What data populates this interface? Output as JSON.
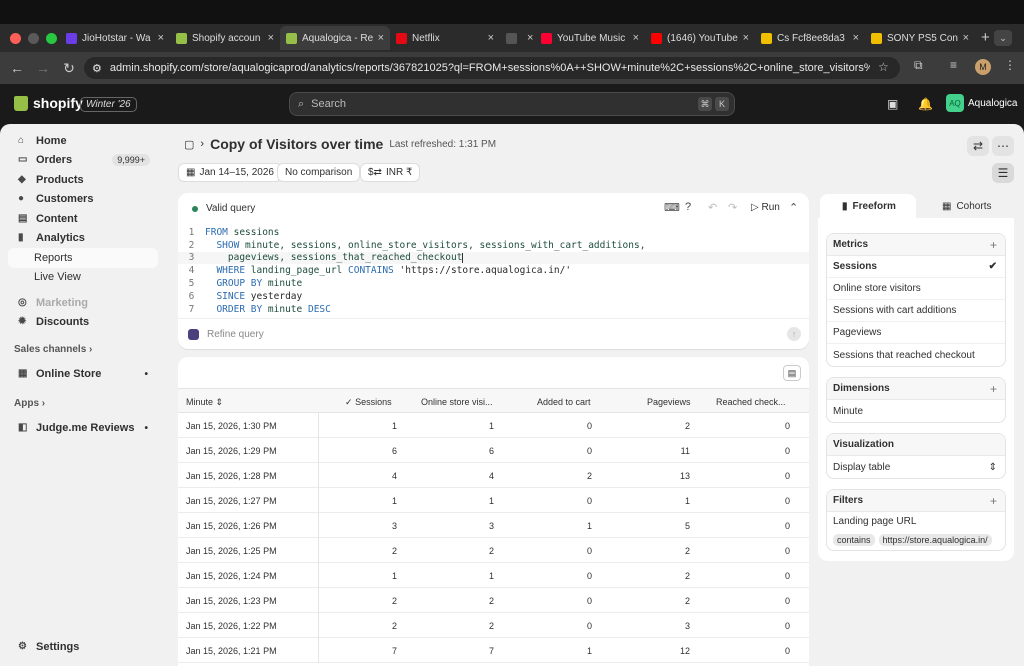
{
  "browser": {
    "tabs": [
      {
        "title": "JioHotstar - Wa",
        "color": "#6a3de8"
      },
      {
        "title": "Shopify accoun",
        "color": "#95bf47"
      },
      {
        "title": "Aqualogica - Re",
        "color": "#95bf47"
      },
      {
        "title": "Netflix",
        "color": "#e50914"
      },
      {
        "title": "",
        "color": "#555555"
      },
      {
        "title": "YouTube Music",
        "color": "#ff0033"
      },
      {
        "title": "(1646) YouTube",
        "color": "#ff0000"
      },
      {
        "title": "Cs Fcf8ee8da3",
        "color": "#f0c000"
      },
      {
        "title": "SONY PS5 Con",
        "color": "#f0c000"
      }
    ],
    "url": "admin.shopify.com/store/aqualogicaprod/analytics/reports/367821025?ql=FROM+sessions%0A++SHOW+minute%2C+sessions%2C+online_store_visitors%2C+ses...",
    "profile_initial": "M"
  },
  "appbar": {
    "logo": "shopify",
    "edition": "Winter '26",
    "search_placeholder": "Search",
    "shortcut_1": "⌘",
    "shortcut_2": "K",
    "store_initials": "AQ",
    "store_name": "Aqualogica"
  },
  "sidebar": {
    "home": "Home",
    "orders": "Orders",
    "orders_count": "9,999+",
    "products": "Products",
    "customers": "Customers",
    "content": "Content",
    "analytics": "Analytics",
    "reports": "Reports",
    "live_view": "Live View",
    "marketing": "Marketing",
    "discounts": "Discounts",
    "sales_channels": "Sales channels",
    "online_store": "Online Store",
    "apps": "Apps",
    "judgeme": "Judge.me Reviews",
    "settings": "Settings"
  },
  "report": {
    "title": "Copy of Visitors over time",
    "refreshed": "Last refreshed: 1:31 PM",
    "date_range": "Jan 14–15, 2026",
    "comparison": "No comparison",
    "currency": "INR ₹",
    "query_status": "Valid query",
    "run_label": "Run",
    "refine_placeholder": "Refine query"
  },
  "query_lines": [
    {
      "num": "1"
    },
    {
      "num": "2"
    },
    {
      "num": "3"
    },
    {
      "num": "4"
    },
    {
      "num": "5"
    },
    {
      "num": "6"
    },
    {
      "num": "7"
    }
  ],
  "query": {
    "l1a": "FROM ",
    "l1b": "sessions",
    "l2a": "  SHOW ",
    "l2b": "minute, sessions, online_store_visitors, sessions_with_cart_additions,",
    "l3": "    pageviews, sessions_that_reached_checkout",
    "l4a": "  WHERE ",
    "l4b": "landing_page_url ",
    "l4c": "CONTAINS ",
    "l4d": "'https://store.aqualogica.in/'",
    "l5a": "  GROUP BY ",
    "l5b": "minute",
    "l6a": "  SINCE ",
    "l6b": "yesterday",
    "l7a": "  ORDER BY ",
    "l7b": "minute ",
    "l7c": "DESC"
  },
  "table": {
    "headers": [
      "Minute",
      "Sessions",
      "Online store visi...",
      "Added to cart",
      "Pageviews",
      "Reached check..."
    ],
    "rows": [
      [
        "Jan 15, 2026, 1:30 PM",
        "1",
        "1",
        "0",
        "2",
        "0"
      ],
      [
        "Jan 15, 2026, 1:29 PM",
        "6",
        "6",
        "0",
        "11",
        "0"
      ],
      [
        "Jan 15, 2026, 1:28 PM",
        "4",
        "4",
        "2",
        "13",
        "0"
      ],
      [
        "Jan 15, 2026, 1:27 PM",
        "1",
        "1",
        "0",
        "1",
        "0"
      ],
      [
        "Jan 15, 2026, 1:26 PM",
        "3",
        "3",
        "1",
        "5",
        "0"
      ],
      [
        "Jan 15, 2026, 1:25 PM",
        "2",
        "2",
        "0",
        "2",
        "0"
      ],
      [
        "Jan 15, 2026, 1:24 PM",
        "1",
        "1",
        "0",
        "2",
        "0"
      ],
      [
        "Jan 15, 2026, 1:23 PM",
        "2",
        "2",
        "0",
        "2",
        "0"
      ],
      [
        "Jan 15, 2026, 1:22 PM",
        "2",
        "2",
        "0",
        "3",
        "0"
      ],
      [
        "Jan 15, 2026, 1:21 PM",
        "7",
        "7",
        "1",
        "12",
        "0"
      ]
    ]
  },
  "panel": {
    "tab_freeform": "Freeform",
    "tab_cohorts": "Cohorts",
    "metrics_title": "Metrics",
    "metrics": [
      "Sessions",
      "Online store visitors",
      "Sessions with cart additions",
      "Pageviews",
      "Sessions that reached checkout"
    ],
    "dimensions_title": "Dimensions",
    "dimension": "Minute",
    "visualization_title": "Visualization",
    "visualization": "Display table",
    "filters_title": "Filters",
    "filter_field": "Landing page URL",
    "filter_op": "contains",
    "filter_value": "https://store.aqualogica.in/"
  }
}
